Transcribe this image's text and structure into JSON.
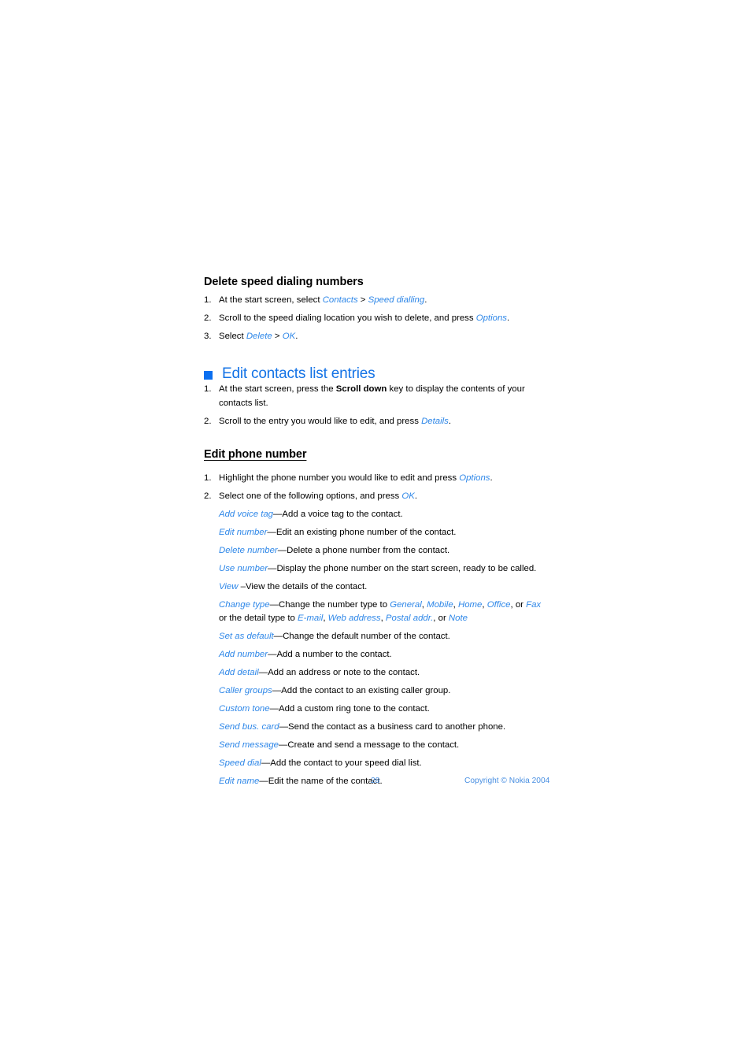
{
  "document": {
    "page_number": "28",
    "copyright": "Copyright © Nokia 2004",
    "accent_blue": "#1473E6",
    "link_blue": "#2E87E8",
    "footer_blue": "#4A90E2"
  },
  "section_delete_speed_dialing": {
    "heading": "Delete speed dialing numbers",
    "steps": [
      {
        "num": "1.",
        "parts": [
          {
            "text": "At the start screen, select ",
            "style": "plain"
          },
          {
            "text": "Contacts",
            "style": "ui"
          },
          {
            "text": " > ",
            "style": "plain"
          },
          {
            "text": "Speed dialling",
            "style": "ui"
          },
          {
            "text": ".",
            "style": "plain"
          }
        ]
      },
      {
        "num": "2.",
        "parts": [
          {
            "text": "Scroll to the speed dialing location you wish to delete, and press ",
            "style": "plain"
          },
          {
            "text": "Options",
            "style": "ui"
          },
          {
            "text": ".",
            "style": "plain"
          }
        ]
      },
      {
        "num": "3.",
        "parts": [
          {
            "text": "Select ",
            "style": "plain"
          },
          {
            "text": "Delete",
            "style": "ui"
          },
          {
            "text": " > ",
            "style": "plain"
          },
          {
            "text": "OK",
            "style": "ui"
          },
          {
            "text": ".",
            "style": "plain"
          }
        ]
      }
    ]
  },
  "section_edit_contacts": {
    "heading": "Edit contacts list entries",
    "bullet_icon": "filled-square-bullet-icon",
    "steps": [
      {
        "num": "1.",
        "parts": [
          {
            "text": "At the start screen, press the ",
            "style": "plain"
          },
          {
            "text": "Scroll down",
            "style": "bold"
          },
          {
            "text": " key to display the contents of your contacts list.",
            "style": "plain"
          }
        ]
      },
      {
        "num": "2.",
        "parts": [
          {
            "text": "Scroll to the entry you would like to edit, and press ",
            "style": "plain"
          },
          {
            "text": "Details",
            "style": "ui"
          },
          {
            "text": ".",
            "style": "plain"
          }
        ]
      }
    ]
  },
  "section_edit_phone_number": {
    "heading": "Edit phone number",
    "steps": [
      {
        "num": "1.",
        "parts": [
          {
            "text": "Highlight the phone number you would like to edit and press ",
            "style": "plain"
          },
          {
            "text": "Options",
            "style": "ui"
          },
          {
            "text": ".",
            "style": "plain"
          }
        ]
      },
      {
        "num": "2.",
        "parts": [
          {
            "text": "Select one of the following options, and press ",
            "style": "plain"
          },
          {
            "text": "OK",
            "style": "ui"
          },
          {
            "text": ".",
            "style": "plain"
          }
        ]
      }
    ],
    "options": [
      {
        "name": "Add voice tag",
        "parts": [
          {
            "text": "Add voice tag",
            "style": "ui"
          },
          {
            "text": "—Add a voice tag to the contact.",
            "style": "plain"
          }
        ]
      },
      {
        "name": "Edit number",
        "parts": [
          {
            "text": "Edit number",
            "style": "ui"
          },
          {
            "text": "—Edit an existing phone number of the contact.",
            "style": "plain"
          }
        ]
      },
      {
        "name": "Delete number",
        "parts": [
          {
            "text": "Delete number",
            "style": "ui"
          },
          {
            "text": "—Delete a phone number from the contact.",
            "style": "plain"
          }
        ]
      },
      {
        "name": "Use number",
        "parts": [
          {
            "text": "Use number",
            "style": "ui"
          },
          {
            "text": "—Display the phone number on the start screen, ready to be called.",
            "style": "plain"
          }
        ]
      },
      {
        "name": "View",
        "parts": [
          {
            "text": "View",
            "style": "ui"
          },
          {
            "text": " –View the details of the contact.",
            "style": "plain"
          }
        ]
      },
      {
        "name": "Change type",
        "parts": [
          {
            "text": "Change type",
            "style": "ui"
          },
          {
            "text": "—Change the number type to ",
            "style": "plain"
          },
          {
            "text": "General",
            "style": "ui"
          },
          {
            "text": ", ",
            "style": "plain"
          },
          {
            "text": "Mobile",
            "style": "ui"
          },
          {
            "text": ", ",
            "style": "plain"
          },
          {
            "text": "Home",
            "style": "ui"
          },
          {
            "text": ", ",
            "style": "plain"
          },
          {
            "text": "Office",
            "style": "ui"
          },
          {
            "text": ", or ",
            "style": "plain"
          },
          {
            "text": "Fax",
            "style": "ui"
          },
          {
            "text": " or the detail type to ",
            "style": "plain"
          },
          {
            "text": "E-mail",
            "style": "ui"
          },
          {
            "text": ", ",
            "style": "plain"
          },
          {
            "text": "Web address",
            "style": "ui"
          },
          {
            "text": ", ",
            "style": "plain"
          },
          {
            "text": "Postal addr.",
            "style": "ui"
          },
          {
            "text": ", or ",
            "style": "plain"
          },
          {
            "text": "Note",
            "style": "ui"
          }
        ]
      },
      {
        "name": "Set as default",
        "parts": [
          {
            "text": "Set as default",
            "style": "ui"
          },
          {
            "text": "—Change the default number of the contact.",
            "style": "plain"
          }
        ]
      },
      {
        "name": "Add number",
        "parts": [
          {
            "text": "Add number",
            "style": "ui"
          },
          {
            "text": "—Add a number to the contact.",
            "style": "plain"
          }
        ]
      },
      {
        "name": "Add detail",
        "parts": [
          {
            "text": "Add detail",
            "style": "ui"
          },
          {
            "text": "—Add an address or note to the contact.",
            "style": "plain"
          }
        ]
      },
      {
        "name": "Caller groups",
        "parts": [
          {
            "text": "Caller groups",
            "style": "ui"
          },
          {
            "text": "—Add the contact to an existing caller group.",
            "style": "plain"
          }
        ]
      },
      {
        "name": "Custom tone",
        "parts": [
          {
            "text": "Custom tone",
            "style": "ui"
          },
          {
            "text": "—Add a custom ring tone to the contact.",
            "style": "plain"
          }
        ]
      },
      {
        "name": "Send bus. card",
        "parts": [
          {
            "text": "Send bus. card",
            "style": "ui"
          },
          {
            "text": "—Send the contact as a business card to another phone.",
            "style": "plain"
          }
        ]
      },
      {
        "name": "Send message",
        "parts": [
          {
            "text": "Send message",
            "style": "ui"
          },
          {
            "text": "—Create and send a message to the contact.",
            "style": "plain"
          }
        ]
      },
      {
        "name": "Speed dial",
        "parts": [
          {
            "text": "Speed dial",
            "style": "ui"
          },
          {
            "text": "—Add the contact to your speed dial list.",
            "style": "plain"
          }
        ]
      },
      {
        "name": "Edit name",
        "parts": [
          {
            "text": "Edit name",
            "style": "ui"
          },
          {
            "text": "—Edit the name of the contact.",
            "style": "plain"
          }
        ]
      }
    ]
  }
}
